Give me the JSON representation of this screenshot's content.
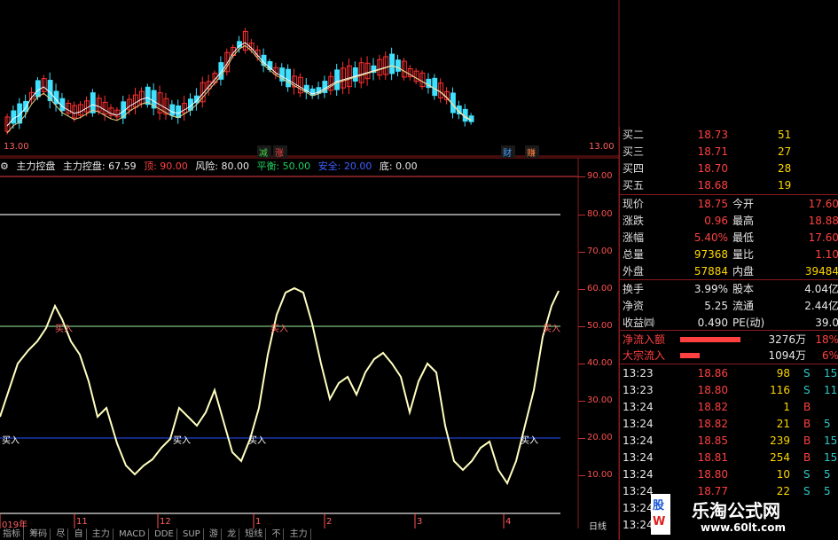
{
  "top_chart": {
    "price_label_left": "13.00",
    "price_label_right": "13.00",
    "badge_down": "减",
    "badge_up": "涨",
    "badge_fin": "财",
    "badge_gain": "赚"
  },
  "indicator": {
    "icon": "gear-icon",
    "name": "主力控盘",
    "main_label": "主力控盘: 67.59",
    "top_label": "顶: 90.00",
    "risk_label": "风险: 80.00",
    "balance_label": "平衡: 50.00",
    "safe_label": "安全: 20.00",
    "bottom_label": "底: 0.00",
    "buy_markers": [
      "买入",
      "买入",
      "买入",
      "买入"
    ],
    "sell_markers": [
      "买入",
      "买入",
      "买入"
    ],
    "axis_ticks": [
      "90.00",
      "80.00",
      "70.00",
      "60.00",
      "50.00",
      "40.00",
      "30.00",
      "20.00",
      "10.00"
    ],
    "period_label": "日线"
  },
  "dates": [
    "019年",
    "11",
    "12",
    "1",
    "2",
    "3",
    "4"
  ],
  "tabs": [
    "指标",
    "筹码",
    "尽",
    "自",
    "主力",
    "MACD",
    "DDE",
    "SUP",
    "游",
    "龙",
    "短线",
    "不",
    "主力"
  ],
  "quote": {
    "order_book": [
      {
        "label": "买二",
        "price": "18.73",
        "vol": "51"
      },
      {
        "label": "买三",
        "price": "18.71",
        "vol": "27"
      },
      {
        "label": "买四",
        "price": "18.70",
        "vol": "28"
      },
      {
        "label": "买五",
        "price": "18.68",
        "vol": "19"
      }
    ],
    "stats": [
      {
        "l1": "现价",
        "v1": "18.75",
        "l2": "今开",
        "v2": "17.60"
      },
      {
        "l1": "涨跌",
        "v1": "0.96",
        "l2": "最高",
        "v2": "18.88"
      },
      {
        "l1": "涨幅",
        "v1": "5.40%",
        "l2": "最低",
        "v2": "17.60"
      },
      {
        "l1": "总量",
        "v1": "97368",
        "l2": "量比",
        "v2": "1.10"
      },
      {
        "l1": "外盘",
        "v1": "57884",
        "l2": "内盘",
        "v2": "39484"
      }
    ],
    "fund": [
      {
        "l1": "换手",
        "v1": "3.99%",
        "l2": "股本",
        "v2": "4.04亿"
      },
      {
        "l1": "净资",
        "v1": "5.25",
        "l2": "流通",
        "v2": "2.44亿"
      },
      {
        "l1": "收益㈣",
        "v1": "0.490",
        "l2": "PE(动)",
        "v2": "39.0"
      }
    ],
    "flows": [
      {
        "label": "净流入额",
        "value": "3276万",
        "pct": "18%",
        "bar": 0.85
      },
      {
        "label": "大宗流入",
        "value": "1094万",
        "pct": "6%",
        "bar": 0.28
      }
    ],
    "ticks": [
      {
        "time": "13:23",
        "price": "18.86",
        "vol": "98",
        "side": "S",
        "n": "15"
      },
      {
        "time": "13:23",
        "price": "18.80",
        "vol": "116",
        "side": "S",
        "n": "11"
      },
      {
        "time": "13:24",
        "price": "18.82",
        "vol": "1",
        "side": "B",
        "n": ""
      },
      {
        "time": "13:24",
        "price": "18.82",
        "vol": "21",
        "side": "B",
        "n": "5"
      },
      {
        "time": "13:24",
        "price": "18.85",
        "vol": "239",
        "side": "B",
        "n": "15"
      },
      {
        "time": "13:24",
        "price": "18.81",
        "vol": "254",
        "side": "B",
        "n": "15"
      },
      {
        "time": "13:24",
        "price": "18.80",
        "vol": "10",
        "side": "S",
        "n": "5"
      },
      {
        "time": "13:24",
        "price": "18.77",
        "vol": "22",
        "side": "S",
        "n": "5"
      },
      {
        "time": "13:24",
        "price": "",
        "vol": "",
        "side": "",
        "n": ""
      },
      {
        "time": "13:24",
        "price": "",
        "vol": "",
        "side": "",
        "n": ""
      }
    ]
  },
  "watermark": {
    "logo_top": "股",
    "logo_bottom": "W",
    "title": "乐淘公式网",
    "url": "www.60lt.com"
  },
  "colors": {
    "indicator_line": "#ffffc0",
    "up_candle": "#ff3030",
    "down_candle": "#40e0ff",
    "panel_border": "#8a1a1a",
    "level_90": "#c03030",
    "level_80": "#e0e0e0",
    "level_50": "#80c080",
    "level_20": "#2040d0",
    "level_0": "#e0e0e0"
  }
}
